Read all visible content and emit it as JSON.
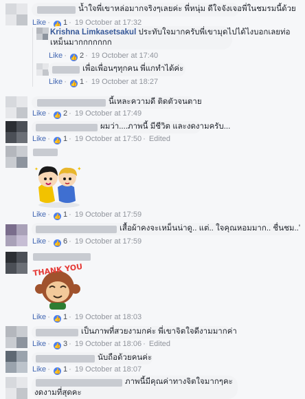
{
  "ui": {
    "like": "Like",
    "dot": "·",
    "thumb_icon": "like-icon"
  },
  "comments": [
    {
      "text": "น้ำใจพี่เขาหล่อมากจริงๆเลยค่ะ พี่หนุ่ม ดีใจจังเจอพี่ในชมรมนี้ด้วย",
      "likes": "1",
      "time": "19 October at 17:32"
    },
    {
      "name": "Krishna Limkasetsakul",
      "text1": "ประทับใจมากครับพี่เขามุดไปได้ไงบอกเลยท่อ",
      "text2": "เหม็นมากกกกกกก",
      "likes": "2",
      "time": "19 October at 17:40"
    },
    {
      "text": "เพื่อเพื่อนๆทุกคน พี่แกทำได้ค่ะ",
      "likes": "1",
      "time": "19 October at 18:27"
    },
    {
      "text": "นี้เหละความดี ติดตัวจนตาย",
      "likes": "2",
      "time": "19 October at 17:49"
    },
    {
      "text": "ผมว่า....ภาพนี้ มีชีวิต และงดงามครับ...",
      "likes": "1",
      "time": "19 October at 17:50",
      "edited": "Edited"
    },
    {
      "likes": "1",
      "time": "19 October at 17:59"
    },
    {
      "text": "เสื้อผ้าคงจะเหม็นน่าดู.. แต่.. ใจคุณหอมมาก.. ชื่นชม..'",
      "likes": "6",
      "time": "19 October at 17:59"
    },
    {
      "likes": "1",
      "time": "19 October at 18:03",
      "sticker_text": "THANK YOU"
    },
    {
      "text": "เป็นภาพที่สวยงามกค่ะ พี่เขาจิตใจดีงามมากค่า",
      "likes": "3",
      "time": "19 October at 18:06",
      "edited": "Edited"
    },
    {
      "text": "นับถือด้วยคนค่ะ",
      "likes": "1",
      "time": "19 October at 18:07"
    },
    {
      "text": "ภาพนี้มีคุณค่าทางจิตใจมากๆคะ",
      "text2": "งดงามที่สุดคะ"
    }
  ]
}
